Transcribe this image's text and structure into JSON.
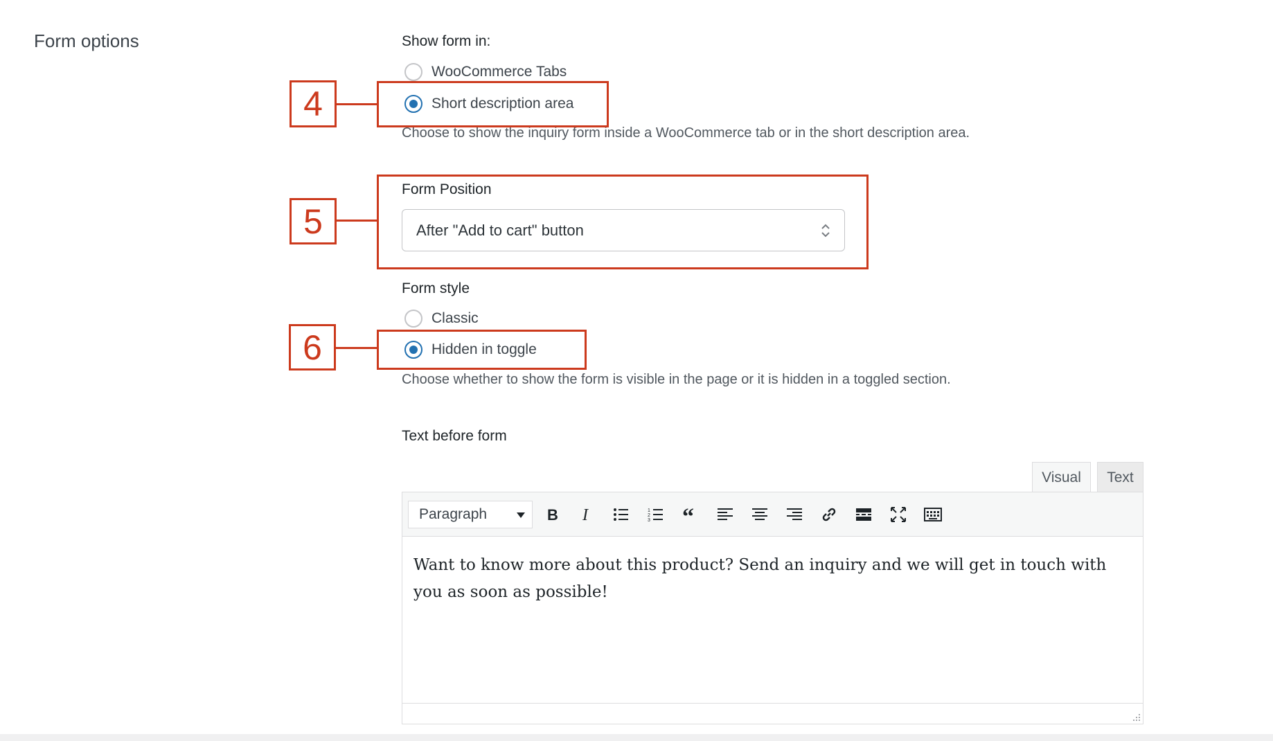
{
  "section": {
    "title": "Form options"
  },
  "show_form_in": {
    "label": "Show form in:",
    "options": [
      {
        "label": "WooCommerce Tabs",
        "checked": false
      },
      {
        "label": "Short description area",
        "checked": true
      }
    ],
    "description": "Choose to show the inquiry form inside a WooCommerce tab or in the short description area."
  },
  "form_position": {
    "label": "Form Position",
    "value": "After \"Add to cart\" button"
  },
  "form_style": {
    "label": "Form style",
    "options": [
      {
        "label": "Classic",
        "checked": false
      },
      {
        "label": "Hidden in toggle",
        "checked": true
      }
    ],
    "description": "Choose whether to show the form is visible in the page or it is hidden in a toggled section."
  },
  "text_before_form": {
    "label": "Text before form",
    "tabs": {
      "visual": "Visual",
      "text": "Text"
    },
    "format": "Paragraph",
    "toolbar_icons": [
      "bold-icon",
      "italic-icon",
      "bulleted-list-icon",
      "numbered-list-icon",
      "blockquote-icon",
      "align-left-icon",
      "align-center-icon",
      "align-right-icon",
      "link-icon",
      "read-more-icon",
      "fullscreen-icon",
      "toolbar-toggle-icon"
    ],
    "content": "Want to know more about this product? Send an inquiry and we will get in touch with you as soon as possible!"
  },
  "callouts": {
    "first": "4",
    "second": "5",
    "third": "6"
  },
  "colors": {
    "accent": "#2271b1",
    "callout": "#cc3a1d"
  }
}
